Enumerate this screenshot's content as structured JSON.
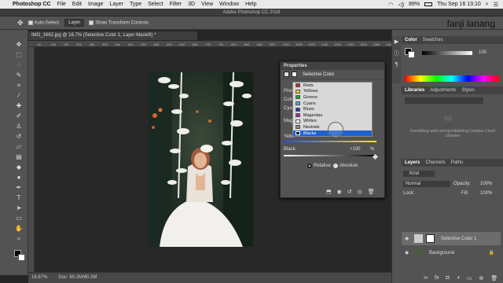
{
  "menubar": {
    "apple": "",
    "app": "Photoshop CC",
    "items": [
      "File",
      "Edit",
      "Image",
      "Layer",
      "Type",
      "Select",
      "Filter",
      "3D",
      "View",
      "Window",
      "Help"
    ],
    "battery": "89%",
    "datetime": "Thu Sep 16 13:10"
  },
  "window_title": "Adobe Photoshop CC 2018",
  "overlay_name": "fanji lanang",
  "options": {
    "auto_select": "Auto-Select:",
    "auto_select_value": "Layer",
    "show_transform": "Show Transform Controls"
  },
  "doc_tab": "IMG_1662.jpg @ 16.7% (Selective Color 1, Layer Mask/8) *",
  "ruler_ticks": [
    "50",
    "100",
    "150",
    "200",
    "250",
    "300",
    "350",
    "400",
    "450",
    "500",
    "550",
    "600",
    "650",
    "700",
    "750",
    "800",
    "850",
    "900",
    "950",
    "1000",
    "1050",
    "1100",
    "1150",
    "1200",
    "1250",
    "1300",
    "1350",
    "1400"
  ],
  "status": {
    "zoom": "16.67%",
    "doc": "Doc: 60.2M/60.2M"
  },
  "properties": {
    "title": "Properties",
    "adjustment": "Selective Color",
    "preset_label": "Prese",
    "colors_label": "Colors",
    "cyan_label": "Cyan",
    "magenta_label": "Mage",
    "yellow_label": "Yello",
    "black_label": "Black:",
    "black_value": "+100",
    "percent": "%",
    "relative": "Relative",
    "absolute": "Absolute",
    "dropdown": [
      {
        "label": "Reds",
        "color": "#cc2020"
      },
      {
        "label": "Yellows",
        "color": "#e8d020"
      },
      {
        "label": "Greens",
        "color": "#20a030"
      },
      {
        "label": "Cyans",
        "color": "#20b8d0"
      },
      {
        "label": "Blues",
        "color": "#2030c0"
      },
      {
        "label": "Magentas",
        "color": "#b020b0"
      },
      {
        "label": "Whites",
        "color": "#ffffff"
      },
      {
        "label": "Neutrals",
        "color": "#888888"
      },
      {
        "label": "Blacks",
        "color": "#111111"
      }
    ]
  },
  "panels": {
    "color_tabs": [
      "Color",
      "Swatches"
    ],
    "color_value": "100",
    "libraries_tabs": [
      "Libraries",
      "Adjustments",
      "Styles"
    ],
    "libraries_message": "Something went wrong initializing Creative Cloud Libraries",
    "layers_tabs": [
      "Layers",
      "Channels",
      "Paths"
    ],
    "kind": "Kind",
    "blend": "Normal",
    "opacity_label": "Opacity:",
    "opacity": "100%",
    "lock_label": "Lock:",
    "fill_label": "Fill:",
    "fill": "100%",
    "layers": [
      {
        "name": "Selective Color 1",
        "selected": true
      },
      {
        "name": "Background",
        "selected": false
      }
    ]
  }
}
